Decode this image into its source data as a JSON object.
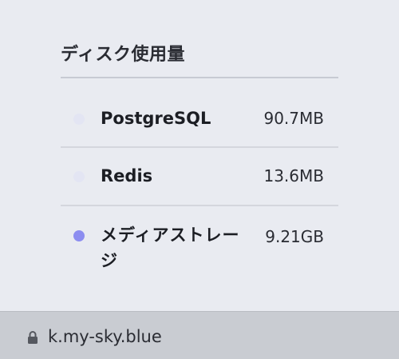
{
  "panel": {
    "title": "ディスク使用量",
    "items": [
      {
        "name": "PostgreSQL",
        "size": "90.7MB",
        "dot_color": "#e3e5f3"
      },
      {
        "name": "Redis",
        "size": "13.6MB",
        "dot_color": "#e3e5f3"
      },
      {
        "name": "メディアストレージ",
        "size": "9.21GB",
        "dot_color": "#8c8df0"
      }
    ]
  },
  "address_bar": {
    "url": "k.my-sky.blue",
    "icon": "lock-icon"
  }
}
